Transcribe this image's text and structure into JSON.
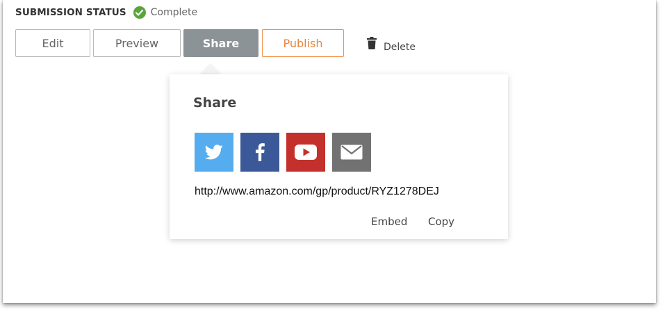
{
  "submission_status": {
    "label": "SUBMISSION STATUS",
    "value": "Complete",
    "status_icon": "check-circle-icon",
    "status_color": "#5aa43c"
  },
  "toolbar": {
    "edit_label": "Edit",
    "preview_label": "Preview",
    "share_label": "Share",
    "publish_label": "Publish",
    "delete_label": "Delete",
    "delete_icon": "trash-icon",
    "active_button": "Share",
    "publish_color": "#e8853e",
    "share_active_color": "#8c9397"
  },
  "share_popover": {
    "title": "Share",
    "social": [
      {
        "name": "twitter",
        "icon": "twitter-icon",
        "color": "#55acee"
      },
      {
        "name": "facebook",
        "icon": "facebook-icon",
        "color": "#3b5998"
      },
      {
        "name": "youtube",
        "icon": "youtube-icon",
        "color": "#c4302b"
      },
      {
        "name": "email",
        "icon": "email-icon",
        "color": "#727272"
      }
    ],
    "url": "http://www.amazon.com/gp/product/RYZ1278DEJ",
    "embed_label": "Embed",
    "copy_label": "Copy"
  }
}
